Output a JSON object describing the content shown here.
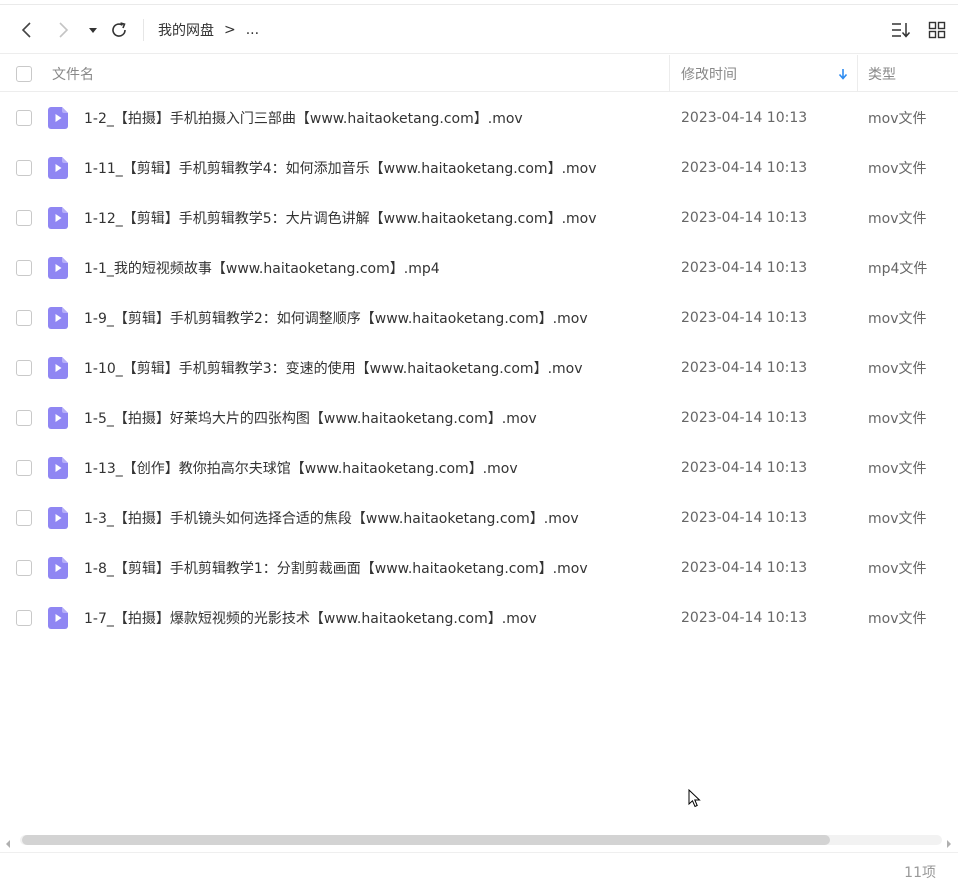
{
  "toolbar": {
    "breadcrumb": [
      "我的网盘",
      ">",
      "..."
    ],
    "icons": [
      "chevron-left-icon",
      "chevron-right-icon",
      "caret-down-icon",
      "refresh-icon",
      "sort-list-icon",
      "grid-view-icon"
    ]
  },
  "header": {
    "name_label": "文件名",
    "time_label": "修改时间",
    "type_label": "类型",
    "sort_icon": "arrow-down-icon"
  },
  "files": [
    {
      "name": "1-2_【拍摄】手机拍摄入门三部曲【www.haitaoketang.com】.mov",
      "modified": "2023-04-14 10:13",
      "type": "mov文件"
    },
    {
      "name": "1-11_【剪辑】手机剪辑教学4：如何添加音乐【www.haitaoketang.com】.mov",
      "modified": "2023-04-14 10:13",
      "type": "mov文件"
    },
    {
      "name": "1-12_【剪辑】手机剪辑教学5：大片调色讲解【www.haitaoketang.com】.mov",
      "modified": "2023-04-14 10:13",
      "type": "mov文件"
    },
    {
      "name": "1-1_我的短视频故事【www.haitaoketang.com】.mp4",
      "modified": "2023-04-14 10:13",
      "type": "mp4文件"
    },
    {
      "name": "1-9_【剪辑】手机剪辑教学2：如何调整顺序【www.haitaoketang.com】.mov",
      "modified": "2023-04-14 10:13",
      "type": "mov文件"
    },
    {
      "name": "1-10_【剪辑】手机剪辑教学3：变速的使用【www.haitaoketang.com】.mov",
      "modified": "2023-04-14 10:13",
      "type": "mov文件"
    },
    {
      "name": "1-5_【拍摄】好莱坞大片的四张构图【www.haitaoketang.com】.mov",
      "modified": "2023-04-14 10:13",
      "type": "mov文件"
    },
    {
      "name": "1-13_【创作】教你拍高尔夫球馆【www.haitaoketang.com】.mov",
      "modified": "2023-04-14 10:13",
      "type": "mov文件"
    },
    {
      "name": "1-3_【拍摄】手机镜头如何选择合适的焦段【www.haitaoketang.com】.mov",
      "modified": "2023-04-14 10:13",
      "type": "mov文件"
    },
    {
      "name": "1-8_【剪辑】手机剪辑教学1：分割剪裁画面【www.haitaoketang.com】.mov",
      "modified": "2023-04-14 10:13",
      "type": "mov文件"
    },
    {
      "name": "1-7_【拍摄】爆款短视频的光影技术【www.haitaoketang.com】.mov",
      "modified": "2023-04-14 10:13",
      "type": "mov文件"
    }
  ],
  "footer": {
    "count": "11项"
  },
  "colors": {
    "accent": "#2f8cf0",
    "file_icon": "#8f86f3",
    "file_icon_fold": "#b7b0f8"
  }
}
